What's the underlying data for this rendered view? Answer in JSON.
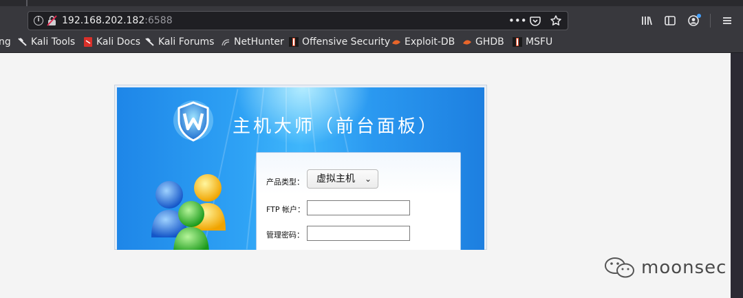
{
  "browser": {
    "url_host": "192.168.202.182",
    "url_port": ":6588",
    "url_actions": [
      "more-actions-icon",
      "pocket-icon",
      "bookmark-star-icon"
    ],
    "toolbar_icons": [
      "library-icon",
      "sidebar-icon",
      "account-icon",
      "menu-icon"
    ]
  },
  "bookmarks": [
    {
      "label": "ng",
      "icon": "none"
    },
    {
      "label": "Kali Tools",
      "icon": "kali-dragon-icon"
    },
    {
      "label": "Kali Docs",
      "icon": "kali-docs-icon"
    },
    {
      "label": "Kali Forums",
      "icon": "kali-dragon-icon"
    },
    {
      "label": "NetHunter",
      "icon": "nethunter-icon"
    },
    {
      "label": "Offensive Security",
      "icon": "offsec-icon"
    },
    {
      "label": "Exploit-DB",
      "icon": "exploitdb-icon"
    },
    {
      "label": "GHDB",
      "icon": "exploitdb-icon"
    },
    {
      "label": "MSFU",
      "icon": "offsec-icon"
    }
  ],
  "login": {
    "title": "主机大师（前台面板）",
    "product_type_label": "产品类型：",
    "product_type_value": "虚拟主机",
    "ftp_account_label": "FTP 帐户：",
    "ftp_account_value": "",
    "admin_password_label": "管理密码：",
    "admin_password_value": ""
  },
  "watermark": {
    "text": "moonsec"
  },
  "colors": {
    "chrome_bg": "#38383d",
    "urlbar_bg": "#1f1f23",
    "panel_blue": "#2fa3f5",
    "page_bg": "#f4f4f4"
  }
}
